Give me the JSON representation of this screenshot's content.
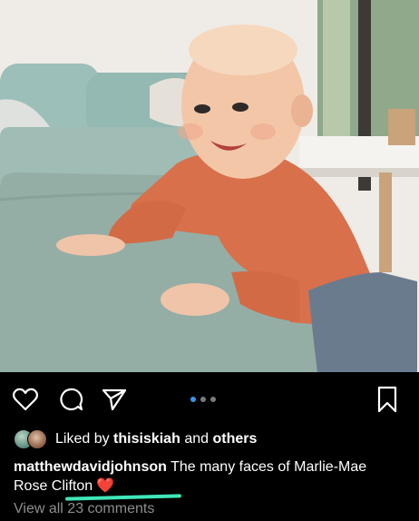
{
  "post": {
    "image_icon": "photo-baby-on-couch",
    "carousel": {
      "total": 3,
      "active": 1
    },
    "actions": {
      "like_icon": "heart-outline-icon",
      "comment_icon": "comment-bubble-icon",
      "share_icon": "paper-plane-icon",
      "save_icon": "bookmark-icon"
    },
    "likes": {
      "prefix": "Liked by",
      "user": "thisiskiah",
      "connector": "and",
      "suffix": "others"
    },
    "caption": {
      "username": "matthewdavidjohnson",
      "text": "The many faces of Marlie-Mae Rose Clifton",
      "emoji": "❤️"
    },
    "view_comments": "View all 23 comments"
  },
  "colors": {
    "background": "#000000",
    "text": "#ffffff",
    "muted": "#8e8e8e",
    "dot_active": "#3897f0",
    "highlight_mark": "#3fe6b8"
  }
}
